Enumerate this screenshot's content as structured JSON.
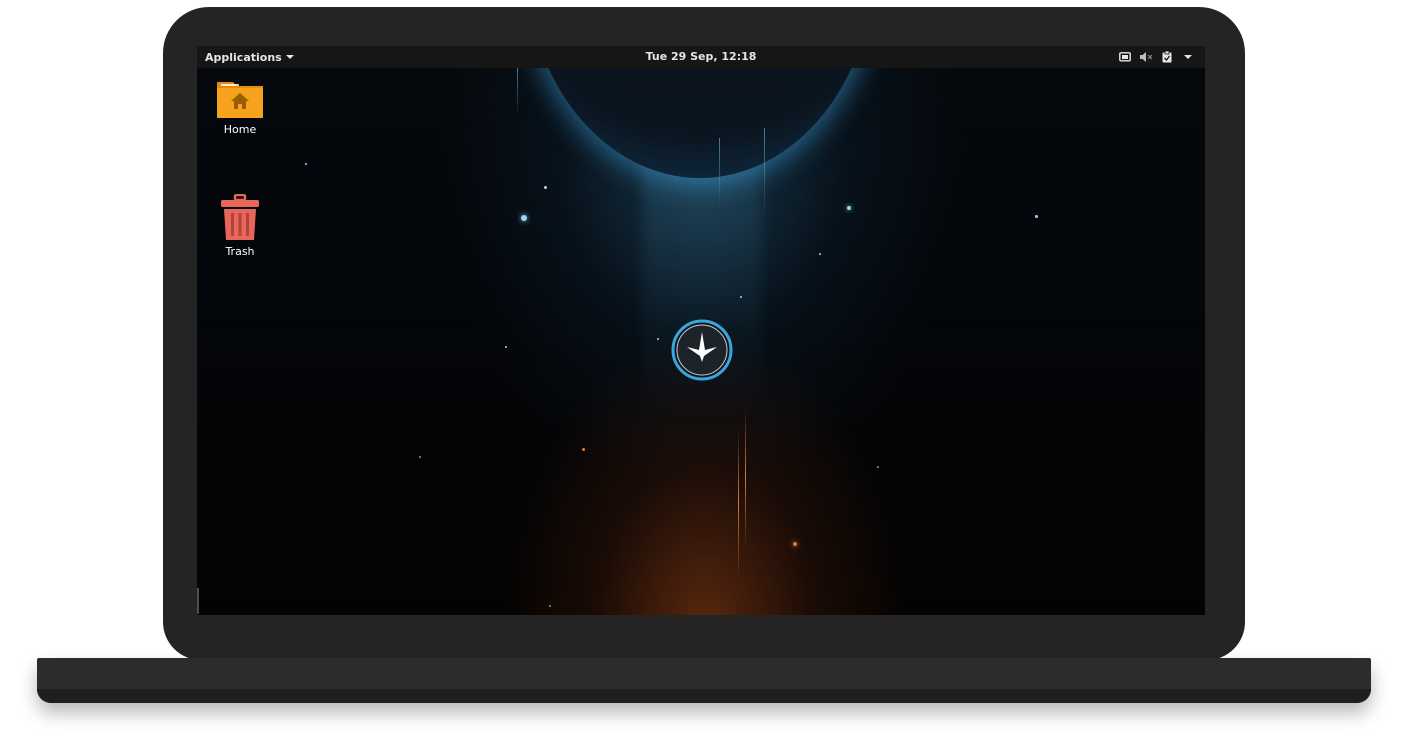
{
  "topbar": {
    "applications_label": "Applications",
    "clock": "Tue 29 Sep, 12:18",
    "tray_icons": [
      "display-icon",
      "volume-muted-icon",
      "clipboard-icon",
      "system-menu-caret-icon"
    ]
  },
  "desktop": {
    "icons": [
      {
        "label": "Home",
        "icon": "home-folder-icon",
        "color": "#f7a21c"
      },
      {
        "label": "Trash",
        "icon": "trash-icon",
        "color": "#e8665a"
      }
    ],
    "logo": "distribution-logo"
  },
  "colors": {
    "panel": "#161616",
    "laptop_frame": "#242424",
    "planet_glow": "#5dc1f2",
    "ember": "#e07a3a"
  }
}
